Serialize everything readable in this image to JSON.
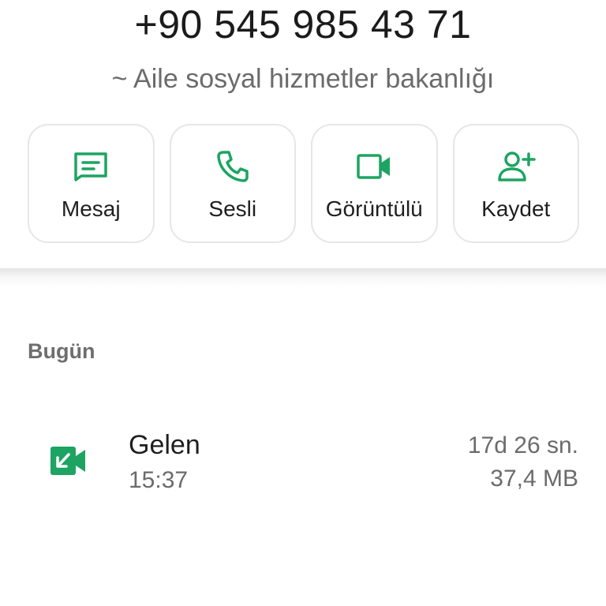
{
  "contact": {
    "phone": "+90 545 985 43 71",
    "name": "~ Aile sosyal hizmetler bakanlığı"
  },
  "actions": [
    {
      "label": "Mesaj",
      "icon": "message-icon"
    },
    {
      "label": "Sesli",
      "icon": "phone-icon"
    },
    {
      "label": "Görüntülü",
      "icon": "video-icon"
    },
    {
      "label": "Kaydet",
      "icon": "add-contact-icon"
    }
  ],
  "history": {
    "section_title": "Bugün",
    "calls": [
      {
        "type": "Gelen",
        "time": "15:37",
        "duration": "17d 26 sn.",
        "size": "37,4 MB",
        "icon": "incoming-video-call-icon"
      }
    ]
  },
  "colors": {
    "accent": "#1da462",
    "text_primary": "#1f1f1f",
    "text_secondary": "#6b6b6b"
  }
}
